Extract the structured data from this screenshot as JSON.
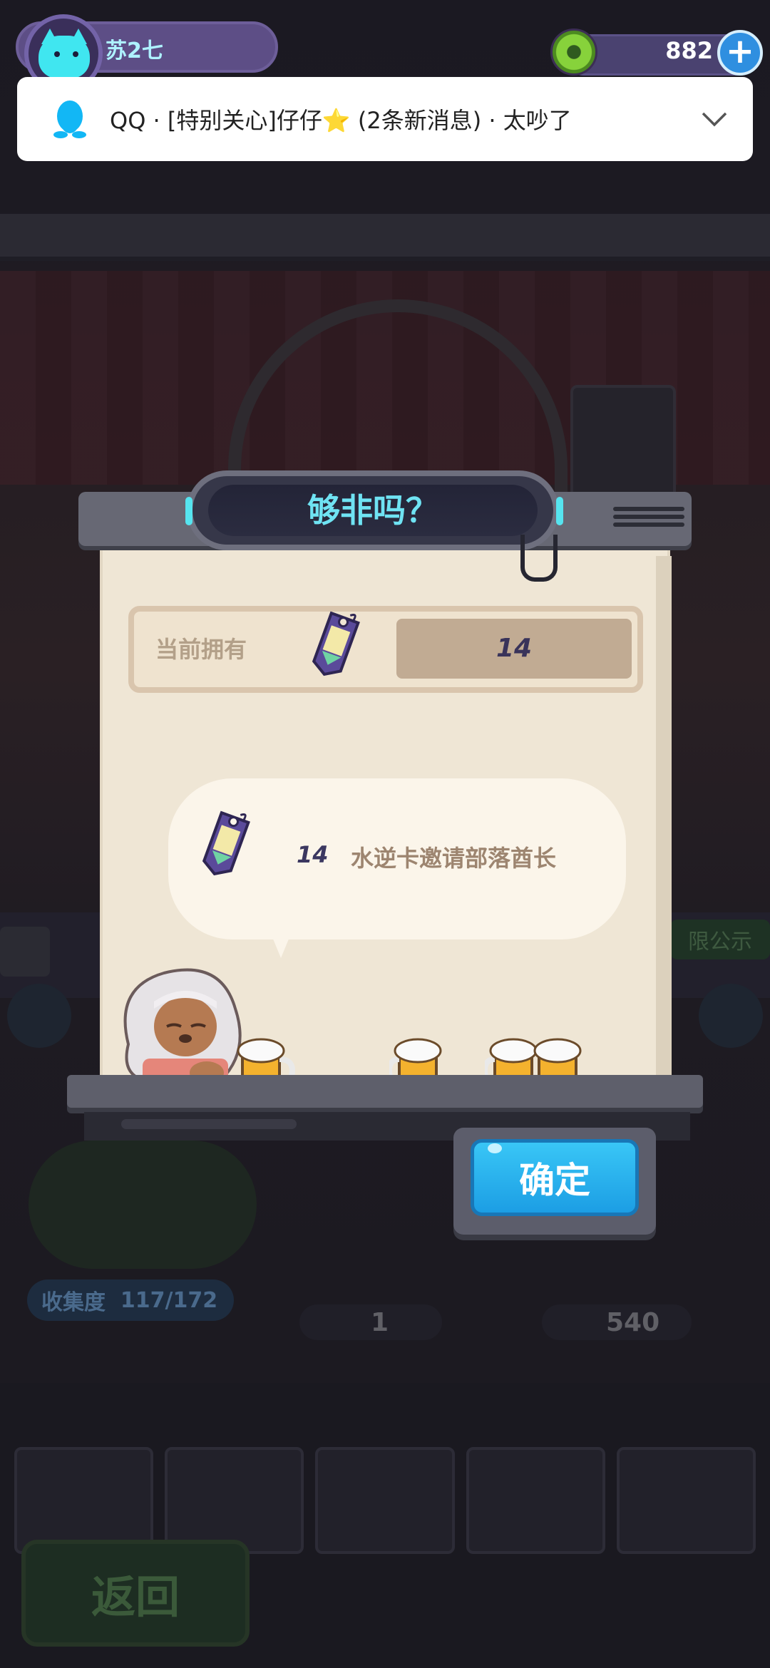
{
  "hud": {
    "player_name": "苏2七",
    "coin_value": "882",
    "plus_label": "+"
  },
  "notification": {
    "app": "QQ",
    "text": "QQ · [特别关心]仔仔⭐ (2条新消息) · 太吵了"
  },
  "dialog": {
    "title": "够非吗？",
    "owned_label": "当前拥有",
    "owned_value": "14",
    "message_count": "14",
    "message_text": "水逆卡邀请部落酋长",
    "ticket_label": "水逆",
    "confirm_label": "确定"
  },
  "background": {
    "collection_label": "收集度",
    "collection_value": "117/172",
    "item_count": "1",
    "coin_count": "540",
    "back_label": "返回",
    "side_badge": "限公示"
  },
  "colors": {
    "title_cyan": "#6fe3f3",
    "confirm_blue": "#1c9ee4",
    "paper": "#efe6d5"
  }
}
